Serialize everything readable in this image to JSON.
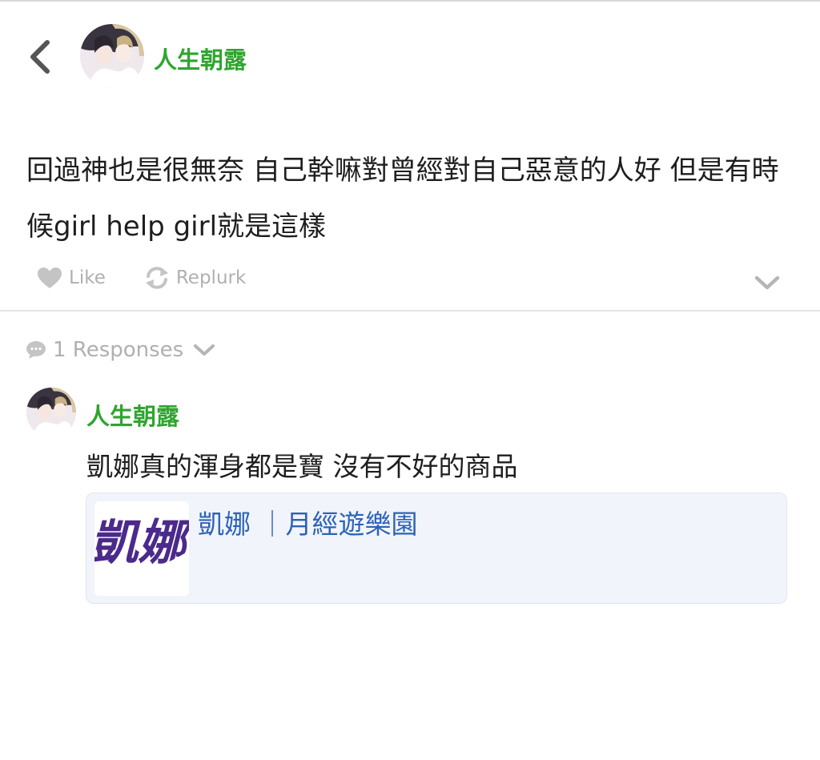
{
  "header": {
    "back_icon": "chevron-left-icon",
    "author": "人生朝露",
    "avatar": "profile-avatar"
  },
  "post": {
    "text": "回過神也是很無奈 自己幹嘛對曾經對自己惡意的人好 但是有時候girl help girl就是這樣"
  },
  "actions": {
    "like_label": "Like",
    "like_icon": "heart-icon",
    "replurk_label": "Replurk",
    "replurk_icon": "replurk-icon",
    "more_icon": "chevron-down-icon"
  },
  "responses": {
    "count_label": "1 Responses",
    "icon": "speech-bubble-icon",
    "items": [
      {
        "author": "人生朝露",
        "text": "凱娜真的渾身都是寶 沒有不好的商品",
        "link_preview": {
          "title": "凱娜 ｜月經遊樂園",
          "thumbnail_text": "凱娜"
        }
      }
    ]
  },
  "colors": {
    "author_green": "#2fa52f",
    "link_blue": "#2c63b6",
    "muted_gray": "#b0b0b0",
    "brand_purple": "#4b2a8c"
  }
}
